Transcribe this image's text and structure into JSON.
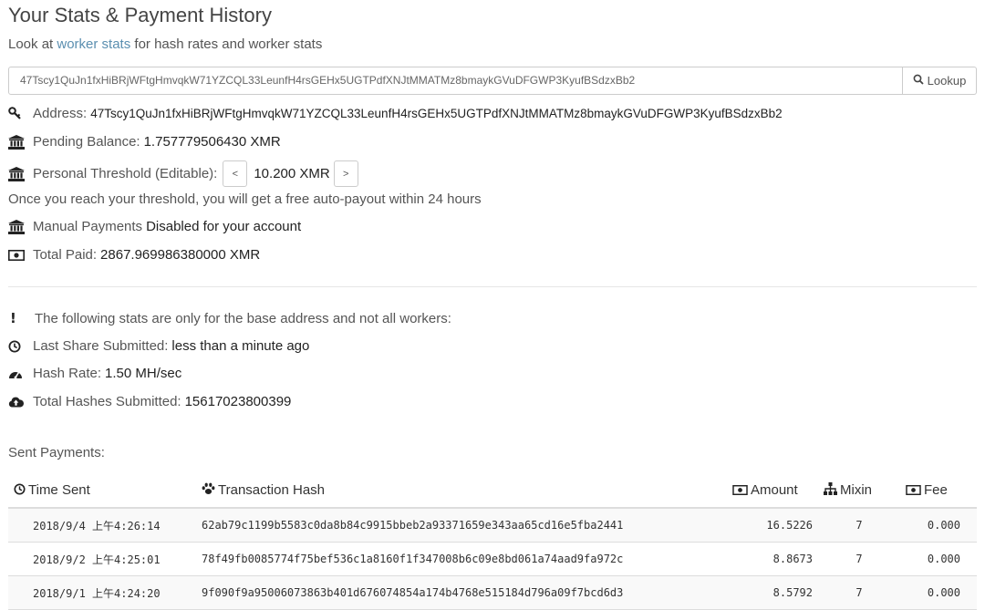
{
  "header": {
    "title": "Your Stats & Payment History",
    "subtitle_prefix": "Look at ",
    "subtitle_link": "worker stats",
    "subtitle_suffix": " for hash rates and worker stats"
  },
  "lookup": {
    "address_value": "47Tscy1QuJn1fxHiBRjWFtgHmvqkW71YZCQL33LeunfH4rsGEHx5UGTPdfXNJtMMATMz8bmaykGVuDFGWP3KyufBSdzxBb2",
    "button_label": "Lookup"
  },
  "account": {
    "address_label": "Address:",
    "address_value": "47Tscy1QuJn1fxHiBRjWFtgHmvqkW71YZCQL33LeunfH4rsGEHx5UGTPdfXNJtMMATMz8bmaykGVuDFGWP3KyufBSdzxBb2",
    "pending_label": "Pending Balance:",
    "pending_value": "1.757779506430 XMR",
    "threshold_label": "Personal Threshold (Editable):",
    "threshold_decrease": "<",
    "threshold_value": "10.200 XMR",
    "threshold_increase": ">",
    "threshold_note": "Once you reach your threshold, you will get a free auto-payout within 24 hours",
    "manual_label": "Manual Payments",
    "manual_value": "Disabled for your account",
    "total_paid_label": "Total Paid:",
    "total_paid_value": "2867.969986380000 XMR"
  },
  "base_stats": {
    "notice": "The following stats are only for the base address and not all workers:",
    "last_share_label": "Last Share Submitted:",
    "last_share_value": "less than a minute ago",
    "hash_rate_label": "Hash Rate:",
    "hash_rate_value": "1.50 MH/sec",
    "total_hashes_label": "Total Hashes Submitted:",
    "total_hashes_value": "15617023800399"
  },
  "payments": {
    "section_label": "Sent Payments:",
    "columns": {
      "time": "Time Sent",
      "hash": "Transaction Hash",
      "amount": "Amount",
      "mixin": "Mixin",
      "fee": "Fee"
    },
    "rows": [
      {
        "time": "2018/9/4 上午4:26:14",
        "hash": "62ab79c1199b5583c0da8b84c9915bbeb2a93371659e343aa65cd16e5fba2441",
        "amount": "16.5226",
        "mixin": "7",
        "fee": "0.000"
      },
      {
        "time": "2018/9/2 上午4:25:01",
        "hash": "78f49fb0085774f75bef536c1a8160f1f347008b6c09e8bd061a74aad9fa972c",
        "amount": "8.8673",
        "mixin": "7",
        "fee": "0.000"
      },
      {
        "time": "2018/9/1 上午4:24:20",
        "hash": "9f090f9a95006073863b401d676074854a174b4768e515184d796a09f7bcd6d3",
        "amount": "8.5792",
        "mixin": "7",
        "fee": "0.000"
      }
    ]
  },
  "colors": {
    "link": "#5b8fb0",
    "text": "#333333",
    "muted": "#555555"
  },
  "icons": [
    "search-icon",
    "key-icon",
    "bank-icon",
    "money-icon",
    "exclamation-icon",
    "clock-icon",
    "dashboard-icon",
    "cloud-upload-icon",
    "paw-icon",
    "sitemap-icon"
  ]
}
